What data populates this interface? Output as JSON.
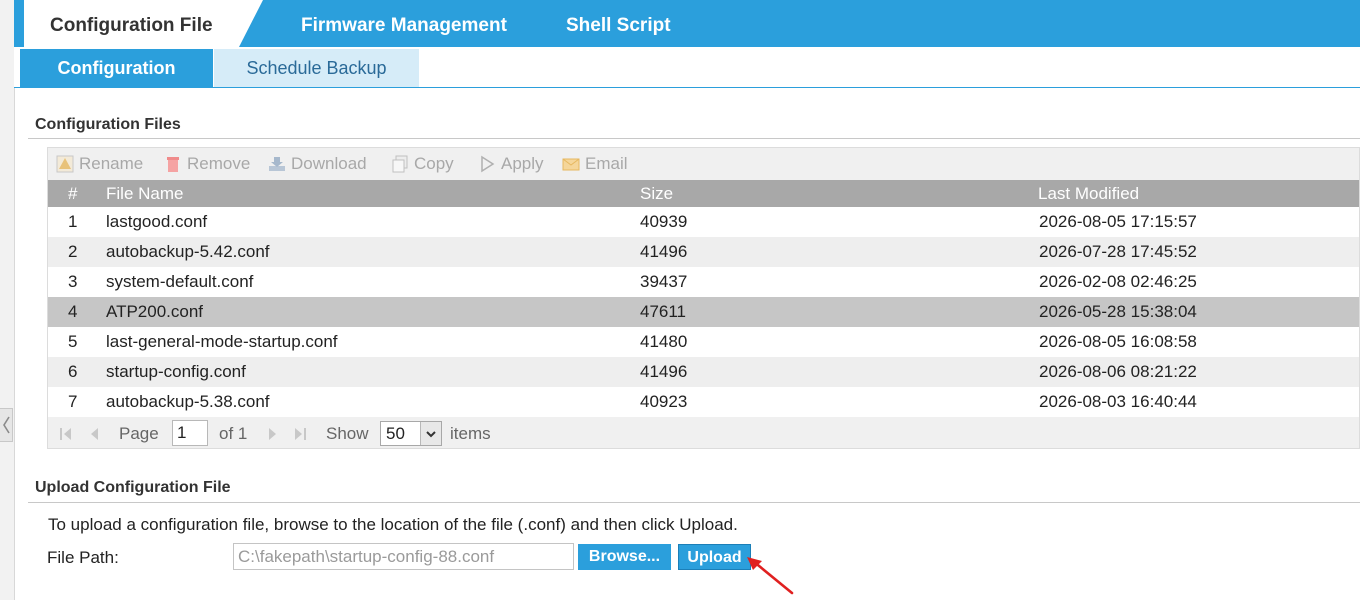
{
  "top_tabs": [
    {
      "label": "Configuration File",
      "active": true
    },
    {
      "label": "Firmware Management",
      "active": false
    },
    {
      "label": "Shell Script",
      "active": false
    }
  ],
  "sub_tabs": [
    {
      "label": "Configuration",
      "active": true
    },
    {
      "label": "Schedule Backup",
      "active": false
    }
  ],
  "config_files": {
    "title": "Configuration Files",
    "toolbar": {
      "rename": "Rename",
      "remove": "Remove",
      "download": "Download",
      "copy": "Copy",
      "apply": "Apply",
      "email": "Email"
    },
    "columns": {
      "num": "#",
      "name": "File Name",
      "size": "Size",
      "modified": "Last Modified"
    },
    "rows": [
      {
        "num": "1",
        "name": "lastgood.conf",
        "size": "40939",
        "modified": "2026-08-05 17:15:57"
      },
      {
        "num": "2",
        "name": "autobackup-5.42.conf",
        "size": "41496",
        "modified": "2026-07-28 17:45:52"
      },
      {
        "num": "3",
        "name": "system-default.conf",
        "size": "39437",
        "modified": "2026-02-08 02:46:25"
      },
      {
        "num": "4",
        "name": "ATP200.conf",
        "size": "47611",
        "modified": "2026-05-28 15:38:04"
      },
      {
        "num": "5",
        "name": "last-general-mode-startup.conf",
        "size": "41480",
        "modified": "2026-08-05 16:08:58"
      },
      {
        "num": "6",
        "name": "startup-config.conf",
        "size": "41496",
        "modified": "2026-08-06 08:21:22"
      },
      {
        "num": "7",
        "name": "autobackup-5.38.conf",
        "size": "40923",
        "modified": "2026-08-03 16:40:44"
      }
    ],
    "selected_row": "4",
    "pager": {
      "page_label": "Page",
      "page_value": "1",
      "of_label": "of 1",
      "show_label": "Show",
      "show_value": "50",
      "items_label": "items"
    }
  },
  "upload": {
    "title": "Upload Configuration File",
    "description": "To upload a configuration file, browse to the location of the file (.conf) and then click Upload.",
    "file_path_label": "File Path:",
    "file_path_value": "C:\\fakepath\\startup-config-88.conf",
    "browse_label": "Browse...",
    "upload_label": "Upload"
  },
  "colors": {
    "accent": "#2b9fdc",
    "arrow": "#e02020",
    "header_grey": "#a8a8a8"
  }
}
